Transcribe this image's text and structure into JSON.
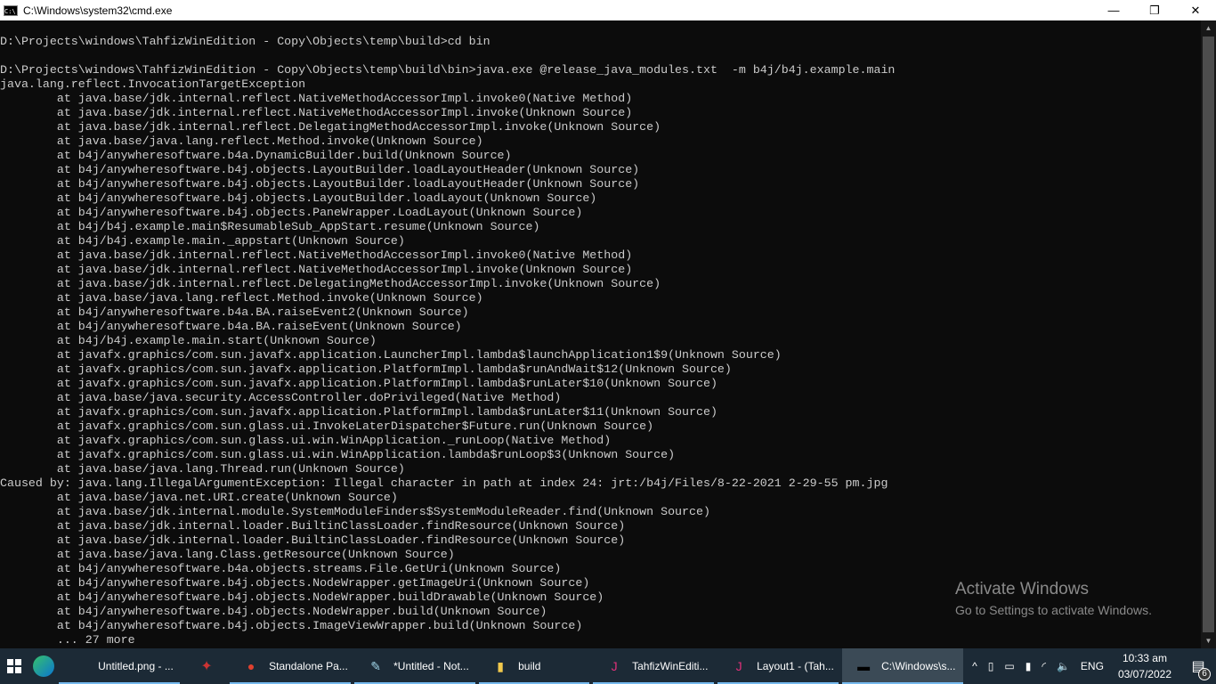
{
  "window": {
    "title": "C:\\Windows\\system32\\cmd.exe",
    "minimize": "—",
    "maximize": "❐",
    "close": "✕"
  },
  "console_lines": [
    "D:\\Projects\\windows\\TahfizWinEdition - Copy\\Objects\\temp\\build>cd bin",
    "",
    "D:\\Projects\\windows\\TahfizWinEdition - Copy\\Objects\\temp\\build\\bin>java.exe @release_java_modules.txt  -m b4j/b4j.example.main",
    "java.lang.reflect.InvocationTargetException",
    "        at java.base/jdk.internal.reflect.NativeMethodAccessorImpl.invoke0(Native Method)",
    "        at java.base/jdk.internal.reflect.NativeMethodAccessorImpl.invoke(Unknown Source)",
    "        at java.base/jdk.internal.reflect.DelegatingMethodAccessorImpl.invoke(Unknown Source)",
    "        at java.base/java.lang.reflect.Method.invoke(Unknown Source)",
    "        at b4j/anywheresoftware.b4a.DynamicBuilder.build(Unknown Source)",
    "        at b4j/anywheresoftware.b4j.objects.LayoutBuilder.loadLayoutHeader(Unknown Source)",
    "        at b4j/anywheresoftware.b4j.objects.LayoutBuilder.loadLayoutHeader(Unknown Source)",
    "        at b4j/anywheresoftware.b4j.objects.LayoutBuilder.loadLayout(Unknown Source)",
    "        at b4j/anywheresoftware.b4j.objects.PaneWrapper.LoadLayout(Unknown Source)",
    "        at b4j/b4j.example.main$ResumableSub_AppStart.resume(Unknown Source)",
    "        at b4j/b4j.example.main._appstart(Unknown Source)",
    "        at java.base/jdk.internal.reflect.NativeMethodAccessorImpl.invoke0(Native Method)",
    "        at java.base/jdk.internal.reflect.NativeMethodAccessorImpl.invoke(Unknown Source)",
    "        at java.base/jdk.internal.reflect.DelegatingMethodAccessorImpl.invoke(Unknown Source)",
    "        at java.base/java.lang.reflect.Method.invoke(Unknown Source)",
    "        at b4j/anywheresoftware.b4a.BA.raiseEvent2(Unknown Source)",
    "        at b4j/anywheresoftware.b4a.BA.raiseEvent(Unknown Source)",
    "        at b4j/b4j.example.main.start(Unknown Source)",
    "        at javafx.graphics/com.sun.javafx.application.LauncherImpl.lambda$launchApplication1$9(Unknown Source)",
    "        at javafx.graphics/com.sun.javafx.application.PlatformImpl.lambda$runAndWait$12(Unknown Source)",
    "        at javafx.graphics/com.sun.javafx.application.PlatformImpl.lambda$runLater$10(Unknown Source)",
    "        at java.base/java.security.AccessController.doPrivileged(Native Method)",
    "        at javafx.graphics/com.sun.javafx.application.PlatformImpl.lambda$runLater$11(Unknown Source)",
    "        at javafx.graphics/com.sun.glass.ui.InvokeLaterDispatcher$Future.run(Unknown Source)",
    "        at javafx.graphics/com.sun.glass.ui.win.WinApplication._runLoop(Native Method)",
    "        at javafx.graphics/com.sun.glass.ui.win.WinApplication.lambda$runLoop$3(Unknown Source)",
    "        at java.base/java.lang.Thread.run(Unknown Source)",
    "Caused by: java.lang.IllegalArgumentException: Illegal character in path at index 24: jrt:/b4j/Files/8-22-2021 2-29-55 pm.jpg",
    "        at java.base/java.net.URI.create(Unknown Source)",
    "        at java.base/jdk.internal.module.SystemModuleFinders$SystemModuleReader.find(Unknown Source)",
    "        at java.base/jdk.internal.loader.BuiltinClassLoader.findResource(Unknown Source)",
    "        at java.base/jdk.internal.loader.BuiltinClassLoader.findResource(Unknown Source)",
    "        at java.base/java.lang.Class.getResource(Unknown Source)",
    "        at b4j/anywheresoftware.b4a.objects.streams.File.GetUri(Unknown Source)",
    "        at b4j/anywheresoftware.b4j.objects.NodeWrapper.getImageUri(Unknown Source)",
    "        at b4j/anywheresoftware.b4j.objects.NodeWrapper.buildDrawable(Unknown Source)",
    "        at b4j/anywheresoftware.b4j.objects.NodeWrapper.build(Unknown Source)",
    "        at b4j/anywheresoftware.b4j.objects.ImageViewWrapper.build(Unknown Source)",
    "        ... 27 more"
  ],
  "watermark": {
    "title": "Activate Windows",
    "subtitle": "Go to Settings to activate Windows."
  },
  "taskbar": {
    "items": [
      {
        "label": "Untitled.png - ...",
        "icon": "paint-icon",
        "running": true
      },
      {
        "label": "Standalone Pa...",
        "icon": "chrome-icon",
        "running": true
      },
      {
        "label": "*Untitled - Not...",
        "icon": "notepad-icon",
        "running": true
      },
      {
        "label": "build",
        "icon": "folder-icon",
        "running": true
      },
      {
        "label": "TahfizWinEditi...",
        "icon": "b4j-icon",
        "running": true
      },
      {
        "label": "Layout1 - (Tah...",
        "icon": "b4j-icon",
        "running": true
      },
      {
        "label": "C:\\Windows\\s...",
        "icon": "cmd-icon",
        "running": true,
        "active": true
      }
    ],
    "tray": {
      "language": "ENG",
      "time": "10:33 am",
      "date": "03/07/2022",
      "notifications": "6"
    }
  }
}
